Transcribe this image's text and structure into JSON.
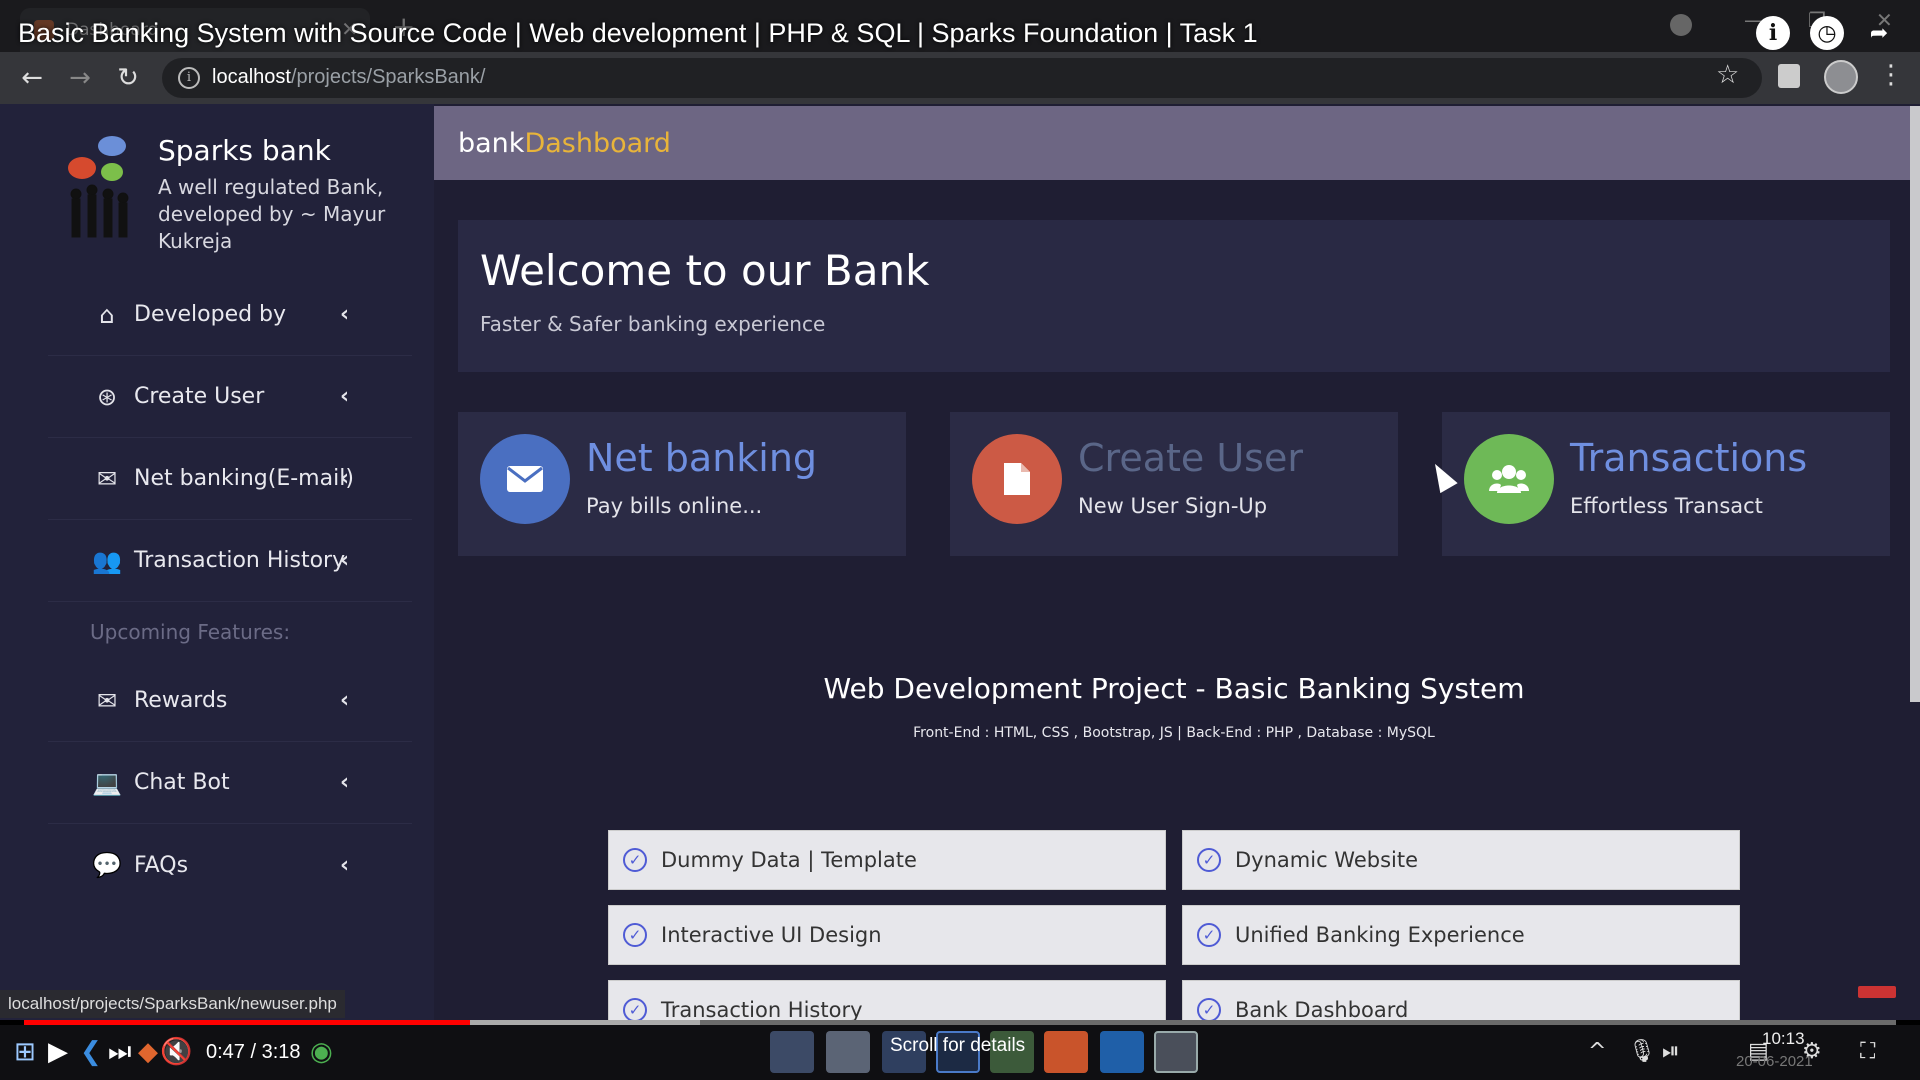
{
  "browser": {
    "tab_title": "Dashboard",
    "video_title": "Basic Banking System with Source Code | Web development | PHP & SQL | Sparks Foundation | Task 1",
    "url_host": "localhost",
    "url_path": "/projects/SparksBank/",
    "status_url": "localhost/projects/SparksBank/newuser.php"
  },
  "sidebar": {
    "brand_name": "Sparks bank",
    "brand_tagline": "A well regulated Bank, developed by ~ Mayur Kukreja",
    "items": [
      {
        "label": "Developed by",
        "icon": "home-icon"
      },
      {
        "label": "Create User",
        "icon": "lifebuoy-icon"
      },
      {
        "label": "Net banking(E-mail)",
        "icon": "envelope-icon"
      },
      {
        "label": "Transaction History",
        "icon": "users-icon"
      }
    ],
    "section_label": "Upcoming Features:",
    "upcoming": [
      {
        "label": "Rewards",
        "icon": "envelope-open-icon"
      },
      {
        "label": "Chat Bot",
        "icon": "laptop-icon"
      },
      {
        "label": "FAQs",
        "icon": "comments-icon"
      }
    ]
  },
  "header": {
    "title_prefix": "bank",
    "title_accent": "Dashboard",
    "accent_color": "#e8b43a"
  },
  "welcome": {
    "heading": "Welcome to our Bank",
    "subheading": "Faster & Safer banking experience"
  },
  "cards": [
    {
      "title": "Net banking",
      "subtitle": "Pay bills online...",
      "icon": "envelope-icon",
      "circle_color": "#4a6fc1",
      "title_color": "#6f8fe0"
    },
    {
      "title": "Create User",
      "subtitle": "New User Sign-Up",
      "icon": "file-icon",
      "circle_color": "#cc5a45",
      "title_color": "#5a6688"
    },
    {
      "title": "Transactions",
      "subtitle": "Effortless Transact",
      "icon": "users-icon",
      "circle_color": "#6eb957",
      "title_color": "#6f8fe0"
    }
  ],
  "project": {
    "title": "Web Development Project - Basic Banking System",
    "stack": "Front-End : HTML, CSS , Bootstrap, JS | Back-End : PHP , Database : MySQL",
    "features": [
      "Dummy Data | Template",
      "Dynamic Website",
      "Interactive UI Design",
      "Unified Banking Experience",
      "Transaction History",
      "Bank Dashboard"
    ]
  },
  "player": {
    "time": "0:47 / 3:18",
    "progress_fraction": 0.238,
    "buffer_fraction": 0.361,
    "scroll_hint": "Scroll for details",
    "clock": "10:13",
    "date": "20-06-2021"
  }
}
